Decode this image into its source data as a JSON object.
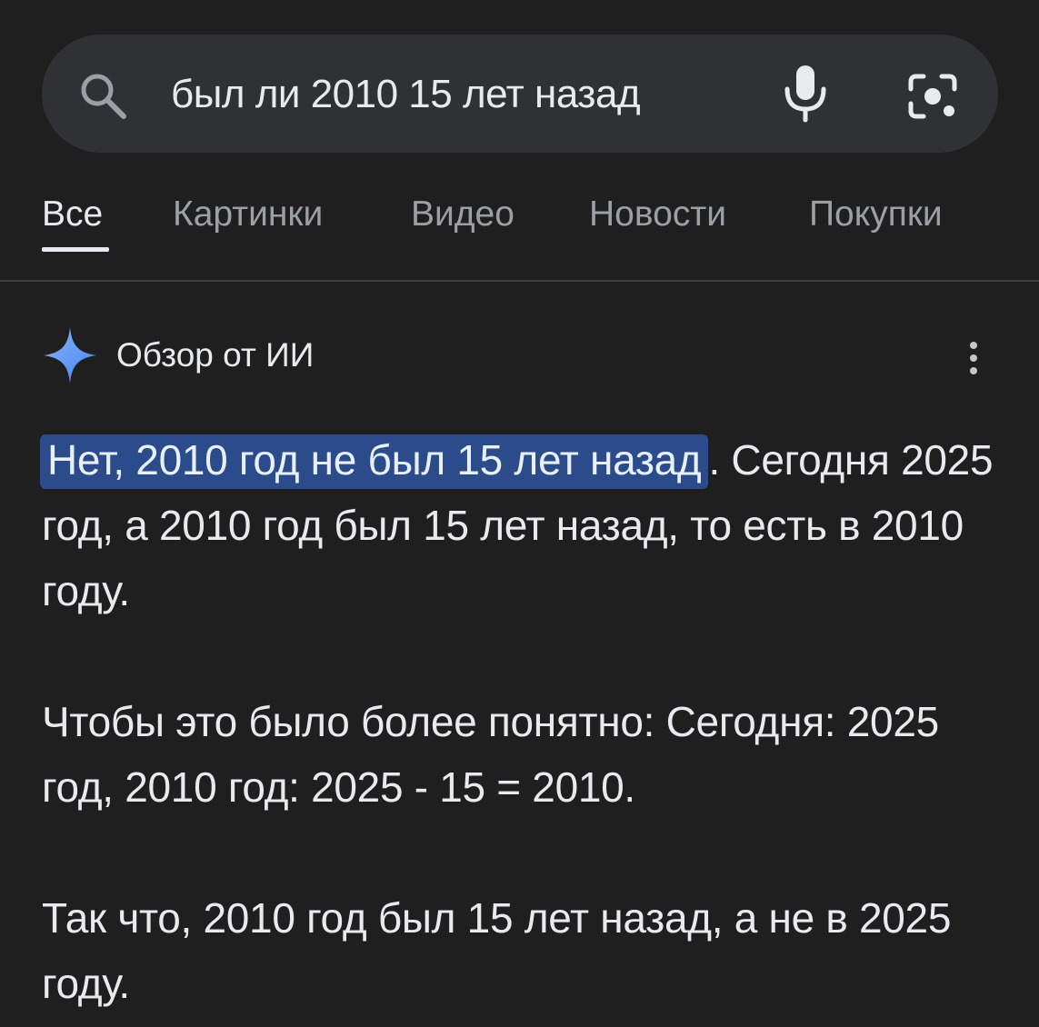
{
  "search": {
    "query": "был ли 2010 15 лет назад",
    "icons": {
      "left": "search-icon",
      "voice": "mic-icon",
      "lens": "camera-lens-icon"
    }
  },
  "tabs": [
    {
      "label": "Все",
      "active": true
    },
    {
      "label": "Картинки",
      "active": false
    },
    {
      "label": "Видео",
      "active": false
    },
    {
      "label": "Новости",
      "active": false
    },
    {
      "label": "Покупки",
      "active": false
    }
  ],
  "ai_overview": {
    "title": "Обзор от ИИ",
    "icon": "sparkle-icon",
    "menu_icon": "more-vert-icon",
    "highlight": "Нет, 2010 год не был 15 лет назад",
    "paragraph1_rest": ". Сегодня 2025 год, а 2010 год был 15 лет назад, то есть в 2010 году.",
    "paragraph2": "Чтобы это было более понятно: Сегодня: 2025 год, 2010 год: 2025 - 15 = 2010.",
    "paragraph3": "Так что, 2010 год был 15 лет назад, а не в 2025 году."
  },
  "colors": {
    "background": "#1f1f1f",
    "search_bar": "#303134",
    "highlight": "#2b4b8a",
    "sparkle": "#4285f4"
  }
}
